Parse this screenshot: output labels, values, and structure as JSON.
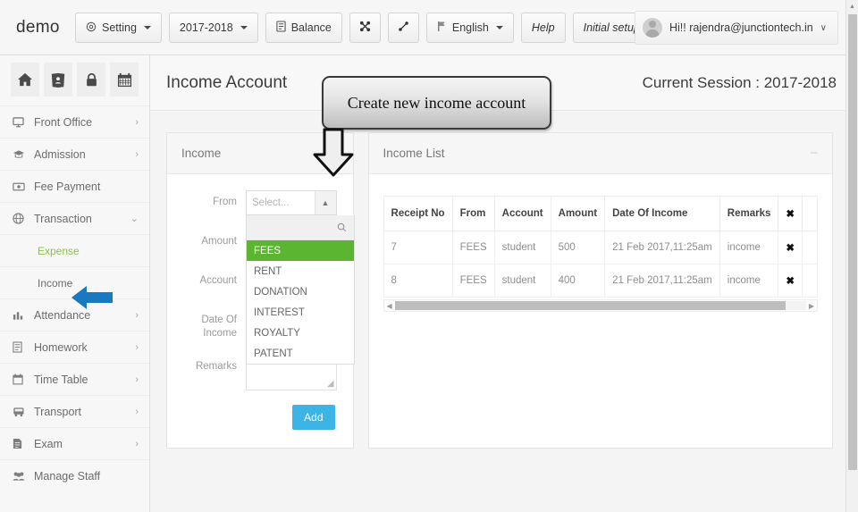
{
  "topbar": {
    "brand": "demo",
    "buttons": [
      {
        "label": "Setting",
        "icon": "gear-icon",
        "caret": true
      },
      {
        "label": "2017-2018",
        "icon": "",
        "caret": true
      },
      {
        "label": "Balance",
        "icon": "book-icon",
        "caret": false
      },
      {
        "label": "",
        "icon": "expand-icon",
        "caret": false
      },
      {
        "label": "",
        "icon": "resize-icon",
        "caret": false
      },
      {
        "label": "English",
        "icon": "flag-icon",
        "caret": true
      },
      {
        "label": "Help",
        "icon": "",
        "caret": false
      },
      {
        "label": "Initial setup",
        "icon": "",
        "caret": false
      }
    ],
    "user": {
      "greeting": "Hi!! rajendra@junctiontech.in",
      "chevron": "∨"
    }
  },
  "sidebar": {
    "quick_icons": [
      "home-icon",
      "address-book-icon",
      "lock-icon",
      "calendar-icon"
    ],
    "items": [
      {
        "label": "Front Office",
        "icon": "monitor-icon",
        "chevron": "›",
        "sub": false
      },
      {
        "label": "Admission",
        "icon": "graduation-cap-icon",
        "chevron": "›",
        "sub": false
      },
      {
        "label": "Fee Payment",
        "icon": "money-icon",
        "chevron": "",
        "sub": false
      },
      {
        "label": "Transaction",
        "icon": "globe-icon",
        "chevron": "⌄",
        "sub": false
      },
      {
        "label": "Expense",
        "icon": "",
        "chevron": "",
        "sub": true,
        "active": true
      },
      {
        "label": "Income",
        "icon": "",
        "chevron": "",
        "sub": true,
        "active": false
      },
      {
        "label": "Attendance",
        "icon": "chart-icon",
        "chevron": "›",
        "sub": false
      },
      {
        "label": "Homework",
        "icon": "document-icon",
        "chevron": "›",
        "sub": false
      },
      {
        "label": "Time Table",
        "icon": "calendar-icon",
        "chevron": "›",
        "sub": false
      },
      {
        "label": "Transport",
        "icon": "bus-icon",
        "chevron": "›",
        "sub": false
      },
      {
        "label": "Exam",
        "icon": "file-icon",
        "chevron": "›",
        "sub": false
      },
      {
        "label": "Manage Staff",
        "icon": "people-icon",
        "chevron": "",
        "sub": false
      }
    ]
  },
  "page": {
    "title": "Income Account",
    "session": "Current Session : 2017-2018"
  },
  "income_panel": {
    "title": "Income",
    "fields": {
      "from_label": "From",
      "from_placeholder": "Select...",
      "amount_label": "Amount",
      "account_label": "Account",
      "date_label": "Date Of Income",
      "remarks_label": "Remarks"
    },
    "dropdown_options": [
      "FEES",
      "RENT",
      "DONATION",
      "INTEREST",
      "ROYALTY",
      "PATENT"
    ],
    "dropdown_highlighted": "FEES",
    "add_label": "Add"
  },
  "income_list": {
    "title": "Income List",
    "collapse_icon": "−",
    "columns": [
      "Receipt No",
      "From",
      "Account",
      "Amount",
      "Date Of Income",
      "Remarks",
      "✖"
    ],
    "rows": [
      {
        "receipt_no": "7",
        "from": "FEES",
        "account": "student",
        "amount": "500",
        "date": "21 Feb 2017,11:25am",
        "remarks": "income",
        "delete": "✖"
      },
      {
        "receipt_no": "8",
        "from": "FEES",
        "account": "student",
        "amount": "400",
        "date": "21 Feb 2017,11:25am",
        "remarks": "income",
        "delete": "✖"
      }
    ]
  },
  "annotations": {
    "callout_text": "Create new income account",
    "down_arrow": "down-arrow-annotation",
    "left_arrow": "left-arrow-annotation"
  },
  "colors": {
    "accent_blue": "#3cb4e5",
    "highlight_green": "#5cb531",
    "expense_green": "#8bc34a",
    "arrow_blue": "#1878c0"
  }
}
